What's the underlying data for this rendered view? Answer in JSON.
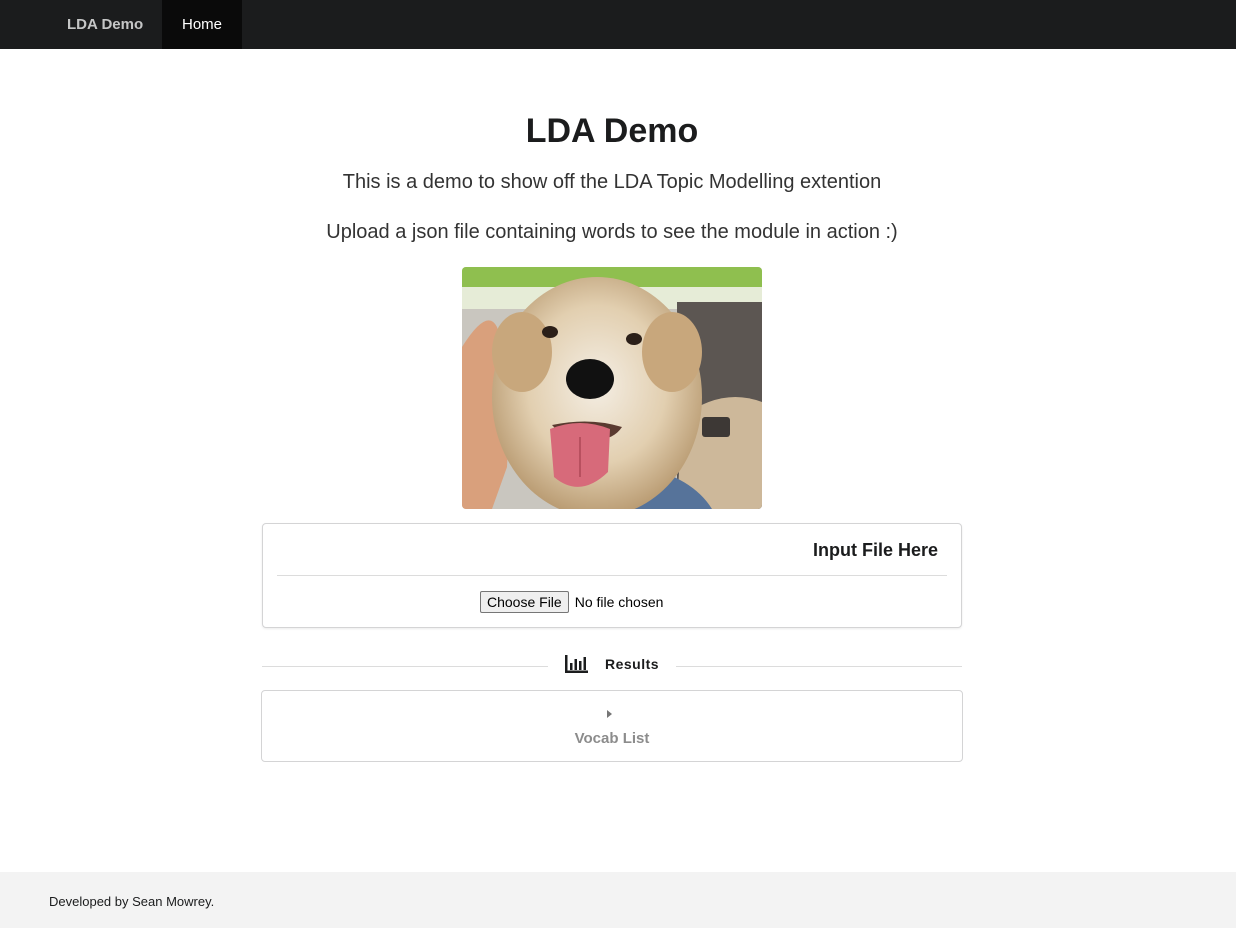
{
  "nav": {
    "brand": "LDA Demo",
    "home": "Home"
  },
  "header": {
    "title": "LDA Demo",
    "line1": "This is a demo to show off the LDA Topic Modelling extention",
    "line2": "Upload a json file containing words to see the module in action :)"
  },
  "photo": {
    "subject": "dog-photo"
  },
  "upload": {
    "header": "Input File Here",
    "button": "Choose File",
    "status": "No file chosen"
  },
  "results": {
    "label": "Results",
    "icon": "bar-chart-icon"
  },
  "accordion": {
    "title": "Vocab List",
    "icon": "caret-right-icon"
  },
  "footer": {
    "text": "Developed by Sean Mowrey."
  }
}
